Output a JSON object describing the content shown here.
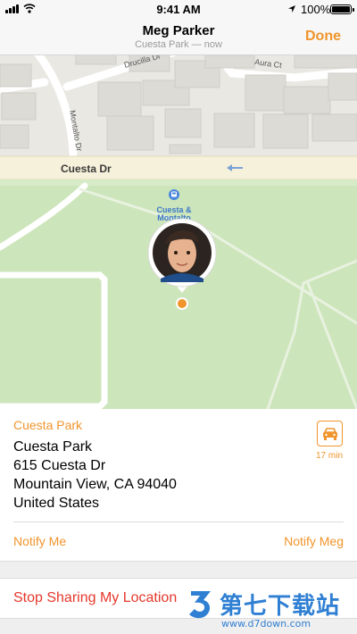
{
  "status_bar": {
    "time": "9:41 AM",
    "battery": "100%",
    "icons": [
      "signal-icon",
      "wifi-icon",
      "location-arrow-icon",
      "battery-icon"
    ]
  },
  "nav": {
    "title": "Meg Parker",
    "subtitle": "Cuesta Park — now",
    "done_label": "Done"
  },
  "map": {
    "street_labels": [
      "Cuesta Dr",
      "Montalto Dr",
      "Drucilla Dr",
      "Aura Ct"
    ],
    "poi_label_line1": "Cuesta &",
    "poi_label_line2": "Montalto",
    "icons": [
      "bus-stop-icon",
      "avatar-pin",
      "location-dot-icon",
      "one-way-arrow-icon"
    ]
  },
  "place": {
    "header": "Cuesta Park",
    "address_lines": [
      "Cuesta Park",
      "615 Cuesta Dr",
      "Mountain View, CA  94040",
      "United States"
    ],
    "drive_time": "17 min",
    "drive_icon": "car-icon"
  },
  "actions": {
    "notify_me": "Notify Me",
    "notify_contact": "Notify Meg",
    "stop_sharing": "Stop Sharing My Location"
  },
  "watermark": {
    "title": "第七下载站",
    "url": "www.d7down.com"
  },
  "colors": {
    "accent": "#f0952c",
    "destructive": "#e5372b",
    "park_green": "#cde5bb",
    "map_land": "#e9e8e3",
    "road": "#f6f1da",
    "watermark_blue": "#2f7fd3"
  }
}
